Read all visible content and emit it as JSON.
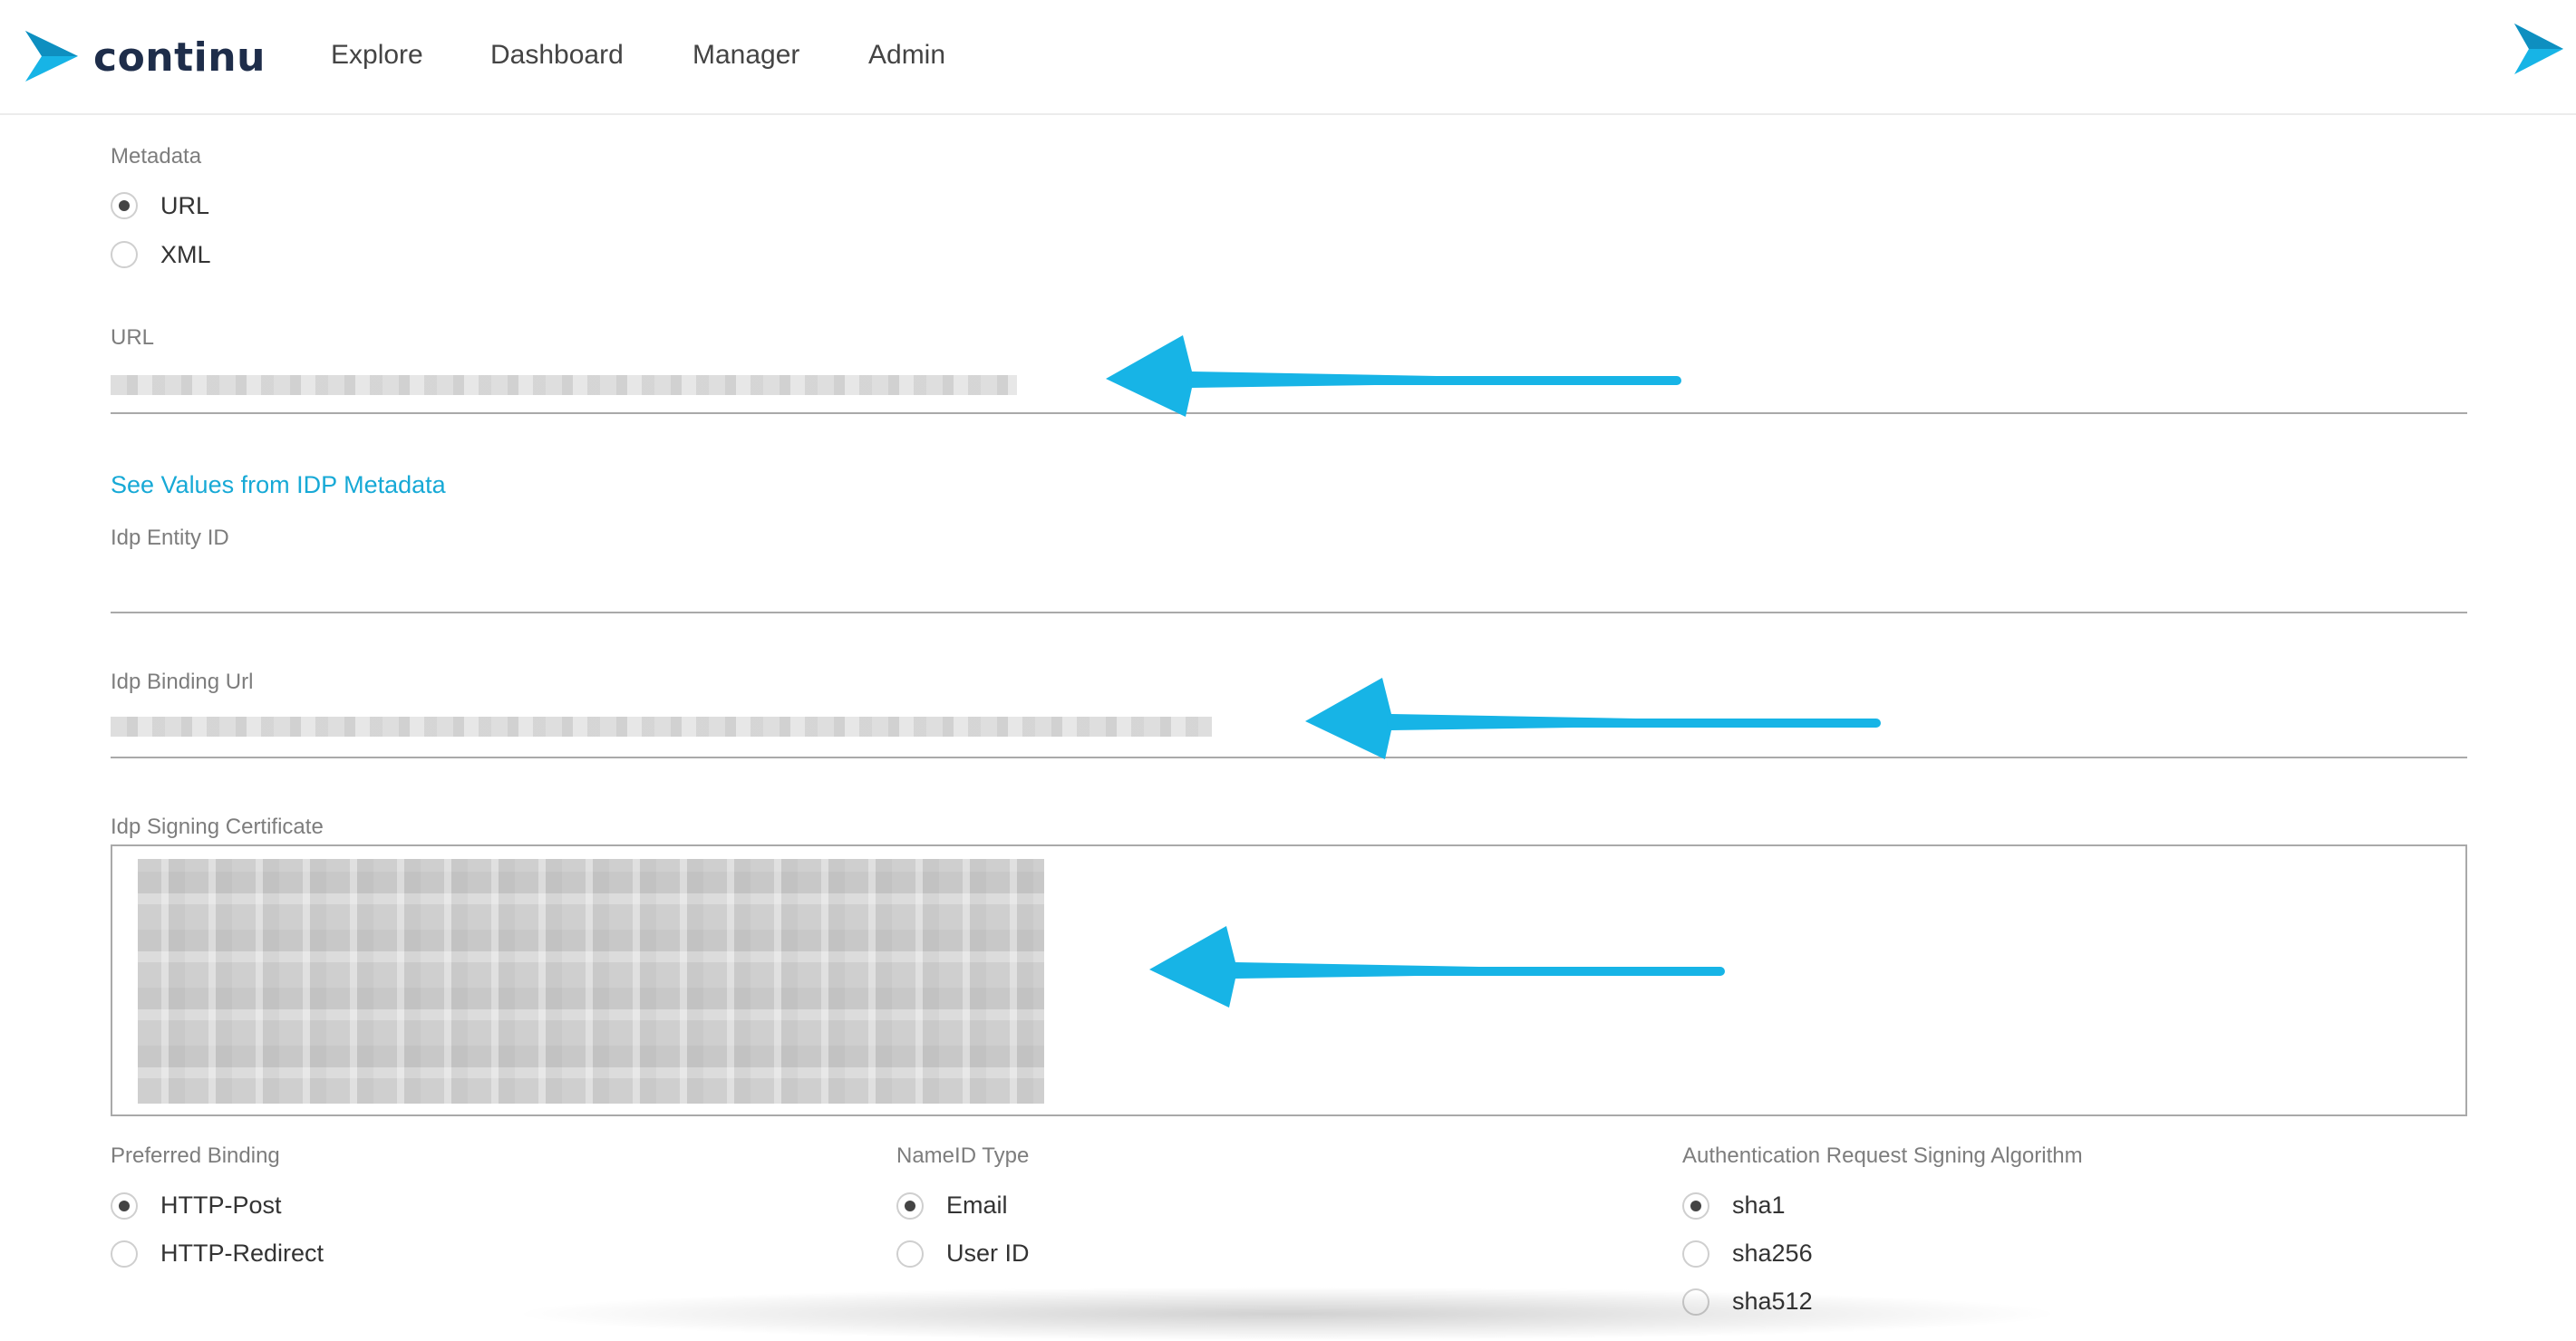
{
  "app": {
    "brand": "continu",
    "nav": [
      "Explore",
      "Dashboard",
      "Manager",
      "Admin"
    ],
    "accent_color": "#17b4e6"
  },
  "form": {
    "metadata": {
      "label": "Metadata",
      "options": [
        "URL",
        "XML"
      ],
      "selected": "URL"
    },
    "url": {
      "label": "URL"
    },
    "see_values_link": "See Values from IDP Metadata",
    "idp_entity_id": {
      "label": "Idp Entity ID"
    },
    "idp_binding_url": {
      "label": "Idp Binding Url"
    },
    "idp_signing_certificate": {
      "label": "Idp Signing Certificate"
    },
    "preferred_binding": {
      "label": "Preferred Binding",
      "options": [
        "HTTP-Post",
        "HTTP-Redirect"
      ],
      "selected": "HTTP-Post"
    },
    "nameid_type": {
      "label": "NameID Type",
      "options": [
        "Email",
        "User ID"
      ],
      "selected": "Email"
    },
    "auth_signing_algorithm": {
      "label": "Authentication Request Signing Algorithm",
      "options": [
        "sha1",
        "sha256",
        "sha512"
      ],
      "selected": "sha1"
    }
  }
}
